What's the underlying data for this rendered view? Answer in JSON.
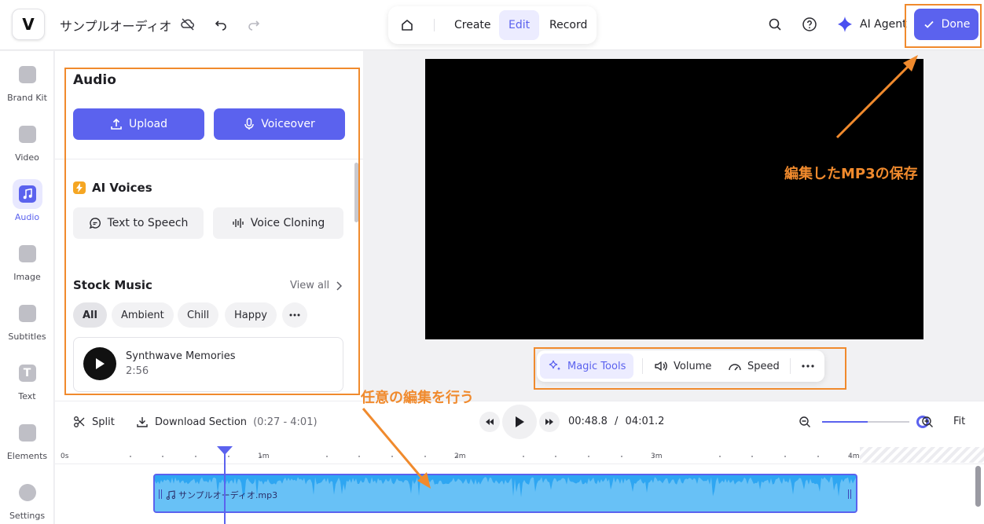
{
  "header": {
    "logo_letter": "V",
    "project_title": "サンプルオーディオ",
    "modes": [
      "Create",
      "Edit",
      "Record"
    ],
    "active_mode": "Edit",
    "ai_agent_label": "AI Agent",
    "done_label": "Done"
  },
  "rail": {
    "items": [
      {
        "label": "Brand Kit",
        "icon": "brand-kit-icon"
      },
      {
        "label": "Video",
        "icon": "video-icon"
      },
      {
        "label": "Audio",
        "icon": "audio-icon"
      },
      {
        "label": "Image",
        "icon": "image-icon"
      },
      {
        "label": "Subtitles",
        "icon": "subtitles-icon"
      },
      {
        "label": "Text",
        "icon": "text-icon"
      },
      {
        "label": "Elements",
        "icon": "elements-icon"
      },
      {
        "label": "Settings",
        "icon": "settings-icon"
      }
    ],
    "active": "Audio"
  },
  "panel": {
    "title": "Audio",
    "upload_label": "Upload",
    "voiceover_label": "Voiceover",
    "ai_voices_title": "AI Voices",
    "tts_label": "Text to Speech",
    "cloning_label": "Voice Cloning",
    "stock_music_title": "Stock Music",
    "view_all_label": "View all",
    "chips": [
      "All",
      "Ambient",
      "Chill",
      "Happy"
    ],
    "active_chip": "All",
    "track": {
      "title": "Synthwave Memories",
      "duration": "2:56"
    }
  },
  "preview_tools": {
    "magic_tools": "Magic Tools",
    "volume": "Volume",
    "speed": "Speed"
  },
  "timeline": {
    "split_label": "Split",
    "download_label": "Download Section",
    "download_range": "(0:27 - 4:01)",
    "current_time": "00:48.8",
    "separator": "/",
    "total_time": "04:01.2",
    "fit_label": "Fit",
    "zoom_level": 0.52,
    "ruler_labels": [
      "0s",
      "1m",
      "2m",
      "3m",
      "4m"
    ],
    "clip_label": "サンプルオーディオ.mp3"
  },
  "annotations": {
    "save_note": "編集したMP3の保存",
    "edit_note": "任意の編集を行う"
  },
  "colors": {
    "accent": "#5b62ee",
    "annotation": "#f08a2d",
    "clip": "#2ea6f2"
  }
}
